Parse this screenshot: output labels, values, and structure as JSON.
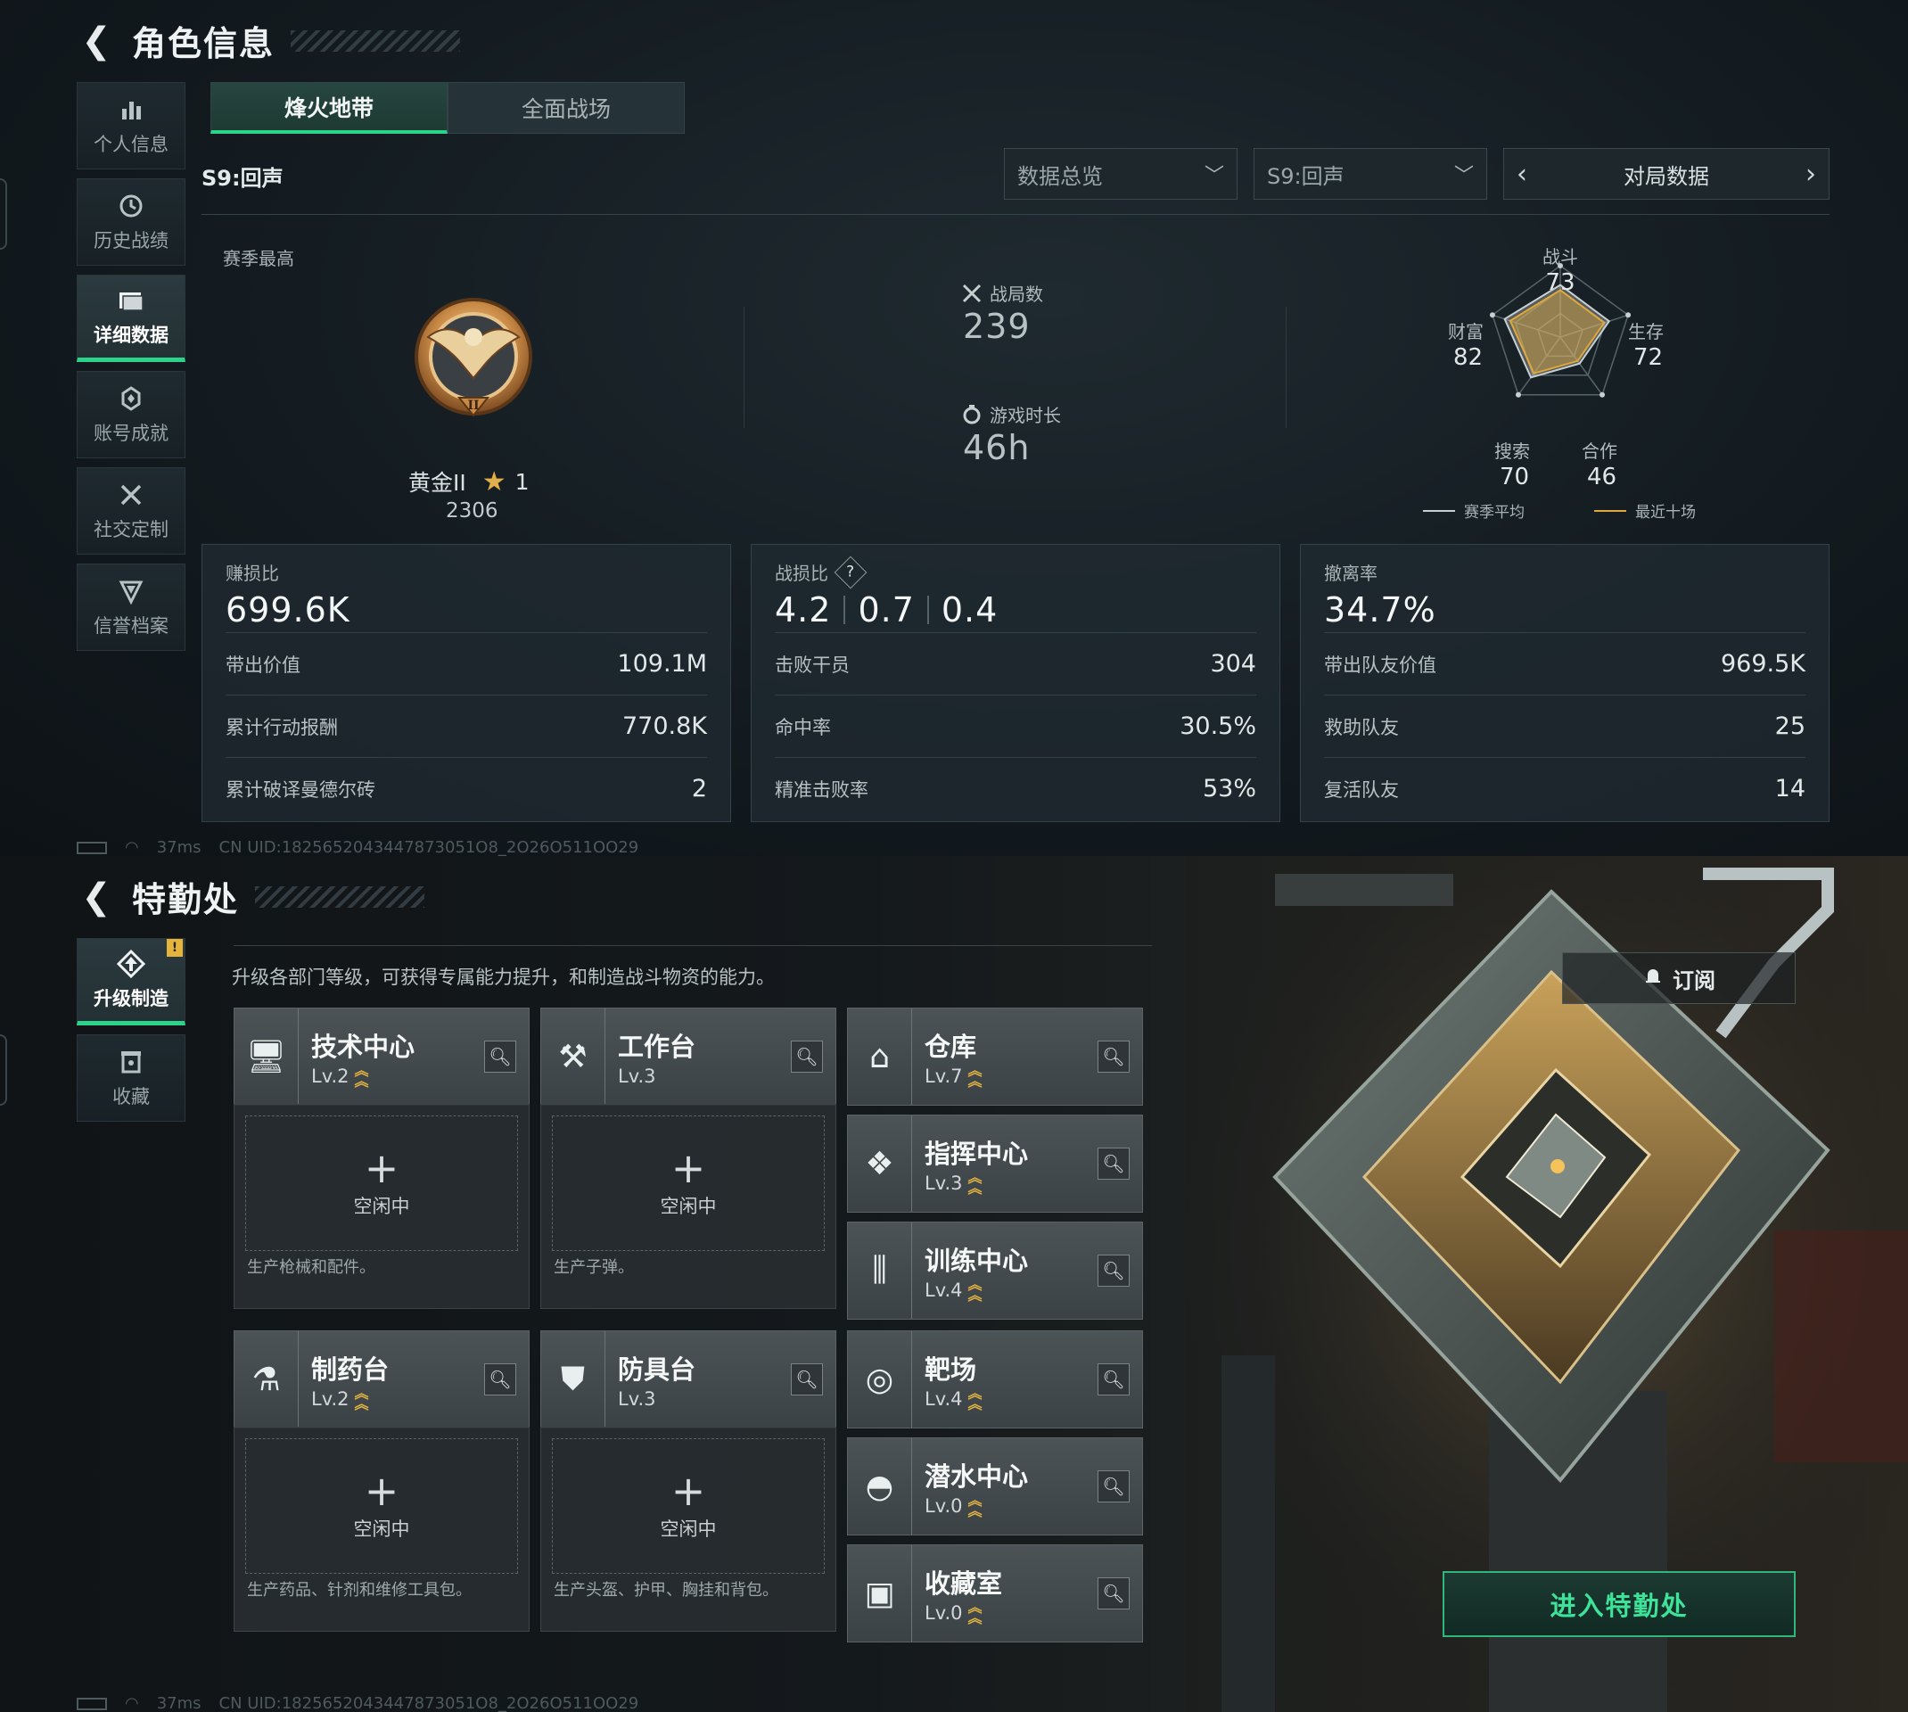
{
  "top": {
    "title": "角色信息",
    "nav": [
      {
        "label": "个人信息",
        "icon": "bar-chart-icon"
      },
      {
        "label": "历史战绩",
        "icon": "clock-icon"
      },
      {
        "label": "详细数据",
        "icon": "folder-icon",
        "active": true
      },
      {
        "label": "账号成就",
        "icon": "achievement-icon"
      },
      {
        "label": "社交定制",
        "icon": "tools-icon"
      },
      {
        "label": "信誉档案",
        "icon": "shield-icon"
      }
    ],
    "tabs": [
      {
        "label": "烽火地带",
        "active": true
      },
      {
        "label": "全面战场",
        "active": false
      }
    ],
    "season_label": "S9:回声",
    "dropdown_overview": "数据总览",
    "dropdown_season": "S9:回声",
    "pager_label": "对局数据",
    "season_best_label": "赛季最高",
    "rank": {
      "name": "黄金II",
      "stars": "1",
      "score": "2306"
    },
    "matches": {
      "label": "战局数",
      "value": "239"
    },
    "playtime": {
      "label": "游戏时长",
      "value": "46h"
    },
    "radar": {
      "axes": [
        {
          "label": "战斗",
          "value": "73"
        },
        {
          "label": "生存",
          "value": "72"
        },
        {
          "label": "合作",
          "value": "46"
        },
        {
          "label": "搜索",
          "value": "70"
        },
        {
          "label": "财富",
          "value": "82"
        }
      ],
      "legend_season": "赛季平均",
      "legend_recent": "最近十场",
      "colors": {
        "season": "#c8cfd0",
        "recent": "#e0a83a"
      }
    },
    "cards": [
      {
        "header": "赚损比",
        "big": "699.6K",
        "rows": [
          {
            "label": "带出价值",
            "value": "109.1M"
          },
          {
            "label": "累计行动报酬",
            "value": "770.8K"
          },
          {
            "label": "累计破译曼德尔砖",
            "value": "2"
          }
        ]
      },
      {
        "header": "战损比",
        "big_parts": [
          "4.2",
          "0.7",
          "0.4"
        ],
        "rows": [
          {
            "label": "击败干员",
            "value": "304"
          },
          {
            "label": "命中率",
            "value": "30.5%"
          },
          {
            "label": "精准击败率",
            "value": "53%"
          }
        ]
      },
      {
        "header": "撤离率",
        "big": "34.7%",
        "rows": [
          {
            "label": "带出队友价值",
            "value": "969.5K"
          },
          {
            "label": "救助队友",
            "value": "25"
          },
          {
            "label": "复活队友",
            "value": "14"
          }
        ]
      }
    ],
    "ping": "37ms",
    "uid": "CN UID:1825652043447873051O8_2O26O511OO29"
  },
  "bottom": {
    "title": "特勤处",
    "nav": [
      {
        "label": "升级制造",
        "icon": "upgrade-icon",
        "active": true,
        "badge": "!"
      },
      {
        "label": "收藏",
        "icon": "collection-icon"
      }
    ],
    "description": "升级各部门等级，可获得专属能力提升，和制造战斗物资的能力。",
    "subscribe_label": "订阅",
    "enter_label": "进入特勤处",
    "departments": [
      {
        "name": "技术中心",
        "level": "Lv.2",
        "icon": "monitor-icon",
        "upgradable": true
      },
      {
        "name": "工作台",
        "level": "Lv.3",
        "icon": "hammer-icon",
        "upgradable": false
      },
      {
        "name": "仓库",
        "level": "Lv.7",
        "icon": "warehouse-icon",
        "upgradable": true
      },
      {
        "name": "指挥中心",
        "level": "Lv.3",
        "icon": "command-icon",
        "upgradable": true
      },
      {
        "name": "训练中心",
        "level": "Lv.4",
        "icon": "dumbbell-icon",
        "upgradable": true
      },
      {
        "name": "制药台",
        "level": "Lv.2",
        "icon": "pharmacy-icon",
        "upgradable": true
      },
      {
        "name": "防具台",
        "level": "Lv.3",
        "icon": "armor-icon",
        "upgradable": false
      },
      {
        "name": "靶场",
        "level": "Lv.4",
        "icon": "target-icon",
        "upgradable": true
      },
      {
        "name": "潜水中心",
        "level": "Lv.0",
        "icon": "diving-icon",
        "upgradable": true
      },
      {
        "name": "收藏室",
        "level": "Lv.0",
        "icon": "collection-room-icon",
        "upgradable": true
      }
    ],
    "slots": [
      {
        "status": "空闲中",
        "desc": "生产枪械和配件。"
      },
      {
        "status": "空闲中",
        "desc": "生产子弹。"
      },
      {
        "status": "空闲中",
        "desc": "生产药品、针剂和维修工具包。"
      },
      {
        "status": "空闲中",
        "desc": "生产头盔、护甲、胸挂和背包。"
      }
    ],
    "ping": "37ms",
    "uid": "CN UID:1825652043447873051O8_2O26O511OO29"
  }
}
